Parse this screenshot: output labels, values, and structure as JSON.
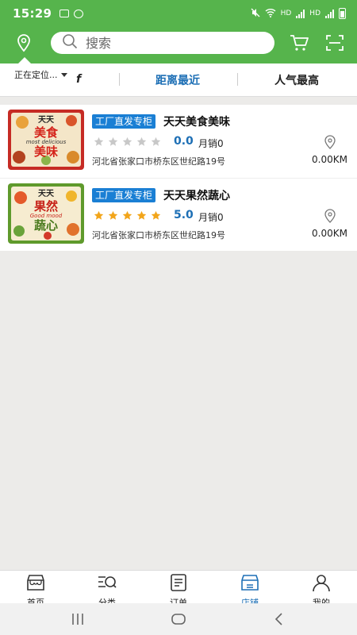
{
  "status_bar": {
    "time": "15:29",
    "net_label_1": "HD",
    "net_label_2": "HD"
  },
  "header": {
    "search_placeholder": "搜索",
    "icons": {
      "location": "location-pin-icon",
      "search": "search-icon",
      "cart": "cart-icon",
      "scan": "scan-icon"
    }
  },
  "filter": {
    "location_label": "正在定位...",
    "fragment_label": "f",
    "tabs": [
      {
        "label": "距离最近",
        "active": true
      },
      {
        "label": "人气最高",
        "active": false
      }
    ]
  },
  "stores": [
    {
      "badge": "工厂直发专柜",
      "name": "天天美食美味",
      "rating": "0.0",
      "stars_filled": 0,
      "sales": "月销0",
      "address": "河北省张家口市桥东区世纪路19号",
      "distance": "0.00KM",
      "image_text_top": "天天",
      "image_text_mid": "美食",
      "image_text_en": "most delicious",
      "image_text_bottom": "美味",
      "image_bg": "#c62b24"
    },
    {
      "badge": "工厂直发专柜",
      "name": "天天果然蔬心",
      "rating": "5.0",
      "stars_filled": 5,
      "sales": "月销0",
      "address": "河北省张家口市桥东区世纪路19号",
      "distance": "0.00KM",
      "image_text_top": "天天",
      "image_text_mid": "果然",
      "image_text_en": "Good mood",
      "image_text_bottom": "蔬心",
      "image_bg": "#5f9a2c"
    }
  ],
  "bottom_nav": [
    {
      "label": "首页",
      "icon": "shop-home-icon",
      "active": false
    },
    {
      "label": "分类",
      "icon": "category-search-icon",
      "active": false
    },
    {
      "label": "订单",
      "icon": "order-list-icon",
      "active": false
    },
    {
      "label": "店铺",
      "icon": "store-icon",
      "active": true
    },
    {
      "label": "我的",
      "icon": "user-icon",
      "active": false
    }
  ],
  "colors": {
    "brand_green": "#56b44c",
    "accent_blue": "#1d6fb5",
    "badge_blue": "#1a7fd4",
    "star_gold": "#f2a51a",
    "star_gray": "#c8c8c8"
  }
}
